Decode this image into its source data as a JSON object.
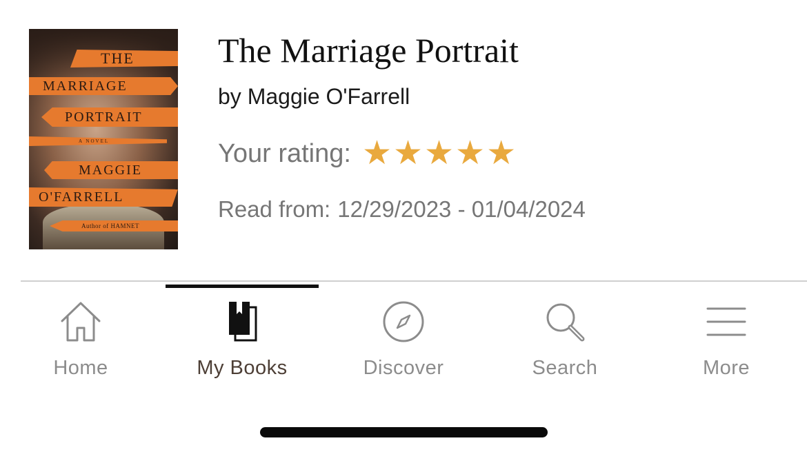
{
  "book": {
    "title": "The Marriage Portrait",
    "author": "by Maggie O'Farrell",
    "rating_label": "Your rating:",
    "rating_value": 5,
    "rating_max": 5,
    "read_label": "Read from:",
    "read_range": "12/29/2023 - 01/04/2024",
    "cover": {
      "line1": "THE",
      "line2": "MARRIAGE",
      "line3": "PORTRAIT",
      "line4": "A NOVEL",
      "line5": "MAGGIE",
      "line6": "O'FARRELL",
      "line7": "Author of HAMNET"
    }
  },
  "tabs": [
    {
      "label": "Home",
      "icon": "home-icon",
      "active": false
    },
    {
      "label": "My Books",
      "icon": "my-books-icon",
      "active": true
    },
    {
      "label": "Discover",
      "icon": "compass-icon",
      "active": false
    },
    {
      "label": "Search",
      "icon": "search-icon",
      "active": false
    },
    {
      "label": "More",
      "icon": "menu-icon",
      "active": false
    }
  ],
  "colors": {
    "star": "#e9a93e",
    "cover_stripe": "#e67a2e",
    "active_tab_text": "#4d3f36",
    "inactive_tab_text": "#8c8c8c"
  }
}
